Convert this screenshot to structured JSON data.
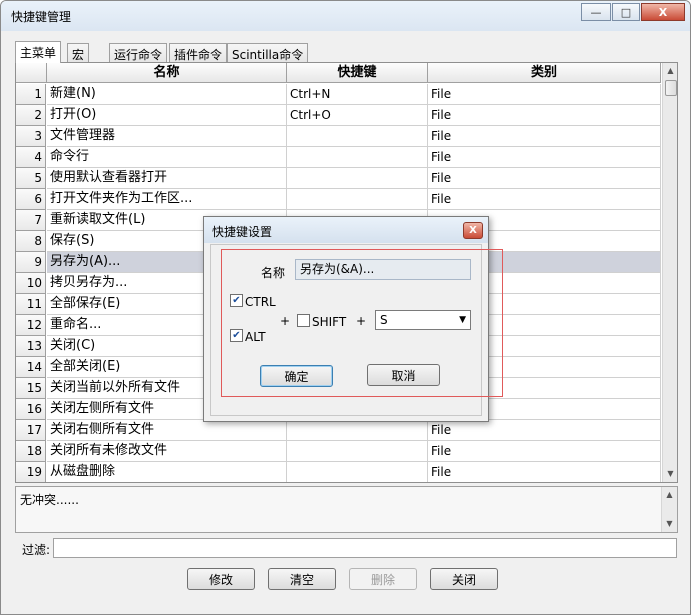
{
  "window": {
    "title": "快捷键管理"
  },
  "caption_buttons": {
    "minimize": "—",
    "maximize": "□",
    "close": "X"
  },
  "tabs": [
    {
      "label": "主菜单",
      "active": true
    },
    {
      "label": "宏",
      "active": false
    },
    {
      "label": "运行命令",
      "active": false
    },
    {
      "label": "插件命令",
      "active": false
    },
    {
      "label": "Scintilla命令",
      "active": false
    }
  ],
  "grid": {
    "columns": [
      "名称",
      "快捷键",
      "类别"
    ],
    "rows": [
      {
        "num": "1",
        "name": "新建(N)",
        "key": "Ctrl+N",
        "cat": "File"
      },
      {
        "num": "2",
        "name": "打开(O)",
        "key": "Ctrl+O",
        "cat": "File"
      },
      {
        "num": "3",
        "name": "文件管理器",
        "key": "",
        "cat": "File"
      },
      {
        "num": "4",
        "name": "命令行",
        "key": "",
        "cat": "File"
      },
      {
        "num": "5",
        "name": "使用默认查看器打开",
        "key": "",
        "cat": "File"
      },
      {
        "num": "6",
        "name": "打开文件夹作为工作区...",
        "key": "",
        "cat": "File"
      },
      {
        "num": "7",
        "name": "重新读取文件(L)",
        "key": "",
        "cat": ""
      },
      {
        "num": "8",
        "name": "保存(S)",
        "key": "",
        "cat": ""
      },
      {
        "num": "9",
        "name": "另存为(A)...",
        "key": "",
        "cat": ""
      },
      {
        "num": "10",
        "name": "拷贝另存为...",
        "key": "",
        "cat": ""
      },
      {
        "num": "11",
        "name": "全部保存(E)",
        "key": "",
        "cat": ""
      },
      {
        "num": "12",
        "name": "重命名...",
        "key": "",
        "cat": ""
      },
      {
        "num": "13",
        "name": "关闭(C)",
        "key": "",
        "cat": ""
      },
      {
        "num": "14",
        "name": "全部关闭(E)",
        "key": "",
        "cat": ""
      },
      {
        "num": "15",
        "name": "关闭当前以外所有文件",
        "key": "",
        "cat": ""
      },
      {
        "num": "16",
        "name": "关闭左侧所有文件",
        "key": "",
        "cat": ""
      },
      {
        "num": "17",
        "name": "关闭右侧所有文件",
        "key": "",
        "cat": "File"
      },
      {
        "num": "18",
        "name": "关闭所有未修改文件",
        "key": "",
        "cat": "File"
      },
      {
        "num": "19",
        "name": "从磁盘删除",
        "key": "",
        "cat": "File"
      }
    ],
    "selected_row": 9
  },
  "status": {
    "text": "无冲突......"
  },
  "filter": {
    "label": "过滤:",
    "value": ""
  },
  "buttons": {
    "modify": "修改",
    "clear": "清空",
    "delete": "删除",
    "close": "关闭"
  },
  "dialog": {
    "title": "快捷键设置",
    "name_label": "名称",
    "name_value": "另存为(&A)...",
    "ctrl": {
      "label": "CTRL",
      "checked": true
    },
    "alt": {
      "label": "ALT",
      "checked": true
    },
    "shift": {
      "label": "SHIFT",
      "checked": false
    },
    "plus": "+",
    "key_value": "S",
    "ok": "确定",
    "cancel": "取消"
  },
  "colors": {
    "selection": "#cfd2dc",
    "highlight_frame": "#e05a5a",
    "default_button_border": "#3c7fb1"
  }
}
